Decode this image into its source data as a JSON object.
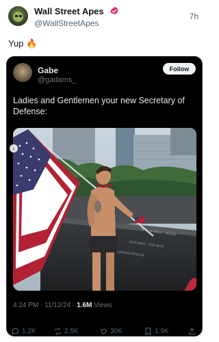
{
  "post": {
    "author_name": "Wall Street Apes",
    "author_handle": "@WallStreetApes",
    "time": "7h",
    "text": "Yup 🔥"
  },
  "quoted": {
    "author_name": "Gabe",
    "author_handle": "@gadams_",
    "follow_label": "Follow",
    "text": "Ladies and Gentlemen your new Secretary of Defense:",
    "timestamp": "4:24 PM · 11/12/24 · ",
    "views_count": "1.6M",
    "views_label": " Views"
  },
  "actions": {
    "reply_count": "1.2K",
    "repost_count": "2.5K",
    "like_count": "30K",
    "bookmark_count": "1.9K"
  },
  "colors": {
    "verified": "#e0245e",
    "dark_card": "#000000",
    "muted_text": "#536471"
  },
  "icons": [
    "verified-badge-icon",
    "reply-icon",
    "repost-icon",
    "like-icon",
    "bookmark-icon",
    "share-icon",
    "carousel-prev-icon"
  ]
}
